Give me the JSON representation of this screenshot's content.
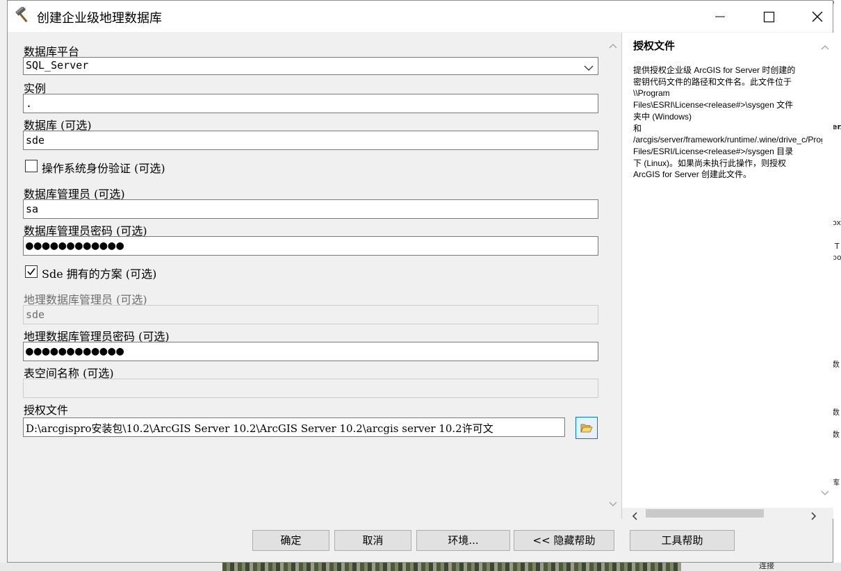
{
  "dialog": {
    "title": "创建企业级地理数据库"
  },
  "form": {
    "platform_label": "数据库平台",
    "platform_value": "SQL_Server",
    "instance_label": "实例",
    "instance_value": ".",
    "database_label": "数据库 (可选)",
    "database_value": "sde",
    "os_auth_label": "操作系统身份验证 (可选)",
    "os_auth_checked": false,
    "db_admin_label": "数据库管理员 (可选)",
    "db_admin_value": "sa",
    "db_admin_pw_label": "数据库管理员密码 (可选)",
    "db_admin_pw_value": "●●●●●●●●●●●●",
    "sde_schema_label": "Sde 拥有的方案 (可选)",
    "sde_schema_checked": true,
    "gdb_admin_label": "地理数据库管理员 (可选)",
    "gdb_admin_value": "sde",
    "gdb_admin_pw_label": "地理数据库管理员密码 (可选)",
    "gdb_admin_pw_value": "●●●●●●●●●●●●",
    "tablespace_label": "表空间名称 (可选)",
    "tablespace_value": "",
    "auth_file_label": "授权文件",
    "auth_file_value": "D:\\arcgispro安装包\\10.2\\ArcGIS Server 10.2\\ArcGIS Server 10.2\\arcgis server 10.2许可文"
  },
  "help": {
    "title": "授权文件",
    "body": "提供授权企业级 ArcGIS for Server 时创建的\n密钥代码文件的路径和文件名。此文件位于\n\\\\Program\nFiles\\ESRI\\License<release#>\\sysgen 文件\n夹中 (Windows)\n和 /arcgis/server/framework/runtime/.wine/drive_c/Program\nFiles/ESRI/License<release#>/sysgen 目录\n下 (Linux)。如果尚未执行此操作，则授权\nArcGIS for Server 创建此文件。"
  },
  "buttons": {
    "ok": "确定",
    "cancel": "取消",
    "environments": "环境...",
    "hide_help": "<< 隐藏帮助",
    "tool_help": "工具帮助"
  },
  "background": {
    "frag_1": "I",
    "frag_2": "er.",
    "frag_3": "ox",
    "frag_4": "T",
    "frag_5": "bo",
    "frag_6": "数",
    "frag_7": "数",
    "frag_8": "数",
    "frag_9": "库",
    "frag_10": "连接"
  }
}
